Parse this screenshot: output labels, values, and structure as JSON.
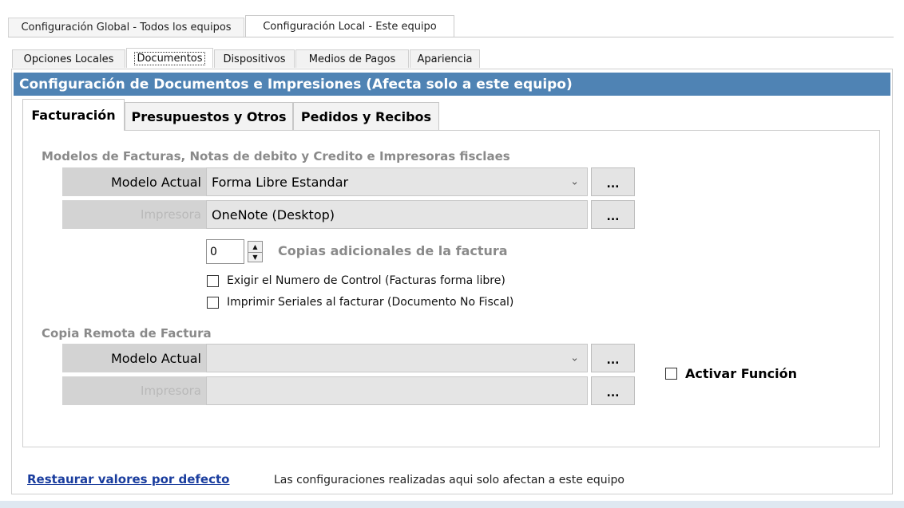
{
  "top_tabs": [
    {
      "label": "Configuración Global - Todos los equipos",
      "active": false
    },
    {
      "label": "Configuración Local - Este equipo",
      "active": true
    }
  ],
  "sub_tabs": [
    {
      "label": "Opciones Locales",
      "active": false
    },
    {
      "label": "Documentos",
      "active": true
    },
    {
      "label": "Dispositivos",
      "active": false
    },
    {
      "label": "Medios de Pagos",
      "active": false
    },
    {
      "label": "Apariencia",
      "active": false
    }
  ],
  "header": {
    "title": "Configuración de Documentos e Impresiones (Afecta solo a este equipo)"
  },
  "doc_tabs": [
    {
      "label": "Facturación",
      "active": true
    },
    {
      "label": "Presupuestos y Otros",
      "active": false
    },
    {
      "label": "Pedidos y Recibos",
      "active": false
    }
  ],
  "facturas": {
    "section_title": "Modelos de Facturas, Notas de debito y Credito e Impresoras fisclaes",
    "modelo_label": "Modelo Actual",
    "modelo_value": "Forma Libre Estandar",
    "impresora_label": "Impresora",
    "impresora_value": "OneNote (Desktop)",
    "browse_label": "...",
    "copies_value": "0",
    "copies_label": "Copias adicionales de la factura",
    "check_control": {
      "label": "Exigir el Numero de Control (Facturas forma libre)",
      "checked": false
    },
    "check_seriales": {
      "label": "Imprimir  Seriales al facturar (Documento No Fiscal)",
      "checked": false
    }
  },
  "remota": {
    "section_title": "Copia Remota de Factura",
    "modelo_label": "Modelo Actual",
    "modelo_value": "",
    "impresora_label": "Impresora",
    "impresora_value": "",
    "browse_label": "...",
    "activar": {
      "label": "Activar Función",
      "checked": false
    }
  },
  "footer": {
    "restore_link": "Restaurar valores por defecto",
    "note": "Las configuraciones realizadas aqui solo afectan a este equipo"
  },
  "colors": {
    "header_bg": "#4f83b4",
    "link": "#1a3d9e"
  }
}
